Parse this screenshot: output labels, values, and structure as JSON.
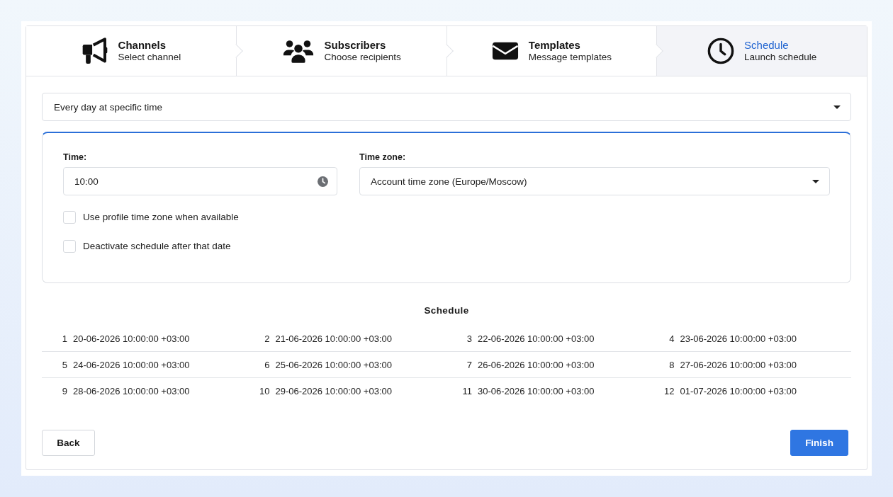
{
  "steps": [
    {
      "title": "Channels",
      "subtitle": "Select channel",
      "selected": false
    },
    {
      "title": "Subscribers",
      "subtitle": "Choose recipients",
      "selected": false
    },
    {
      "title": "Templates",
      "subtitle": "Message templates",
      "selected": false
    },
    {
      "title": "Schedule",
      "subtitle": "Launch schedule",
      "selected": true
    }
  ],
  "frequency_select": {
    "value": "Every day at specific time"
  },
  "time_field": {
    "label": "Time:",
    "value": "10:00"
  },
  "timezone_select": {
    "label": "Time zone:",
    "value": "Account time zone (Europe/Moscow)"
  },
  "options": [
    {
      "label": "Use profile time zone when available",
      "checked": false
    },
    {
      "label": "Deactivate schedule after that date",
      "checked": false
    }
  ],
  "schedule": {
    "title": "Schedule",
    "entries": [
      {
        "number": "1",
        "datetime": "20-06-2026 10:00:00 +03:00"
      },
      {
        "number": "2",
        "datetime": "21-06-2026 10:00:00 +03:00"
      },
      {
        "number": "3",
        "datetime": "22-06-2026 10:00:00 +03:00"
      },
      {
        "number": "4",
        "datetime": "23-06-2026 10:00:00 +03:00"
      },
      {
        "number": "5",
        "datetime": "24-06-2026 10:00:00 +03:00"
      },
      {
        "number": "6",
        "datetime": "25-06-2026 10:00:00 +03:00"
      },
      {
        "number": "7",
        "datetime": "26-06-2026 10:00:00 +03:00"
      },
      {
        "number": "8",
        "datetime": "27-06-2026 10:00:00 +03:00"
      },
      {
        "number": "9",
        "datetime": "28-06-2026 10:00:00 +03:00"
      },
      {
        "number": "10",
        "datetime": "29-06-2026 10:00:00 +03:00"
      },
      {
        "number": "11",
        "datetime": "30-06-2026 10:00:00 +03:00"
      },
      {
        "number": "12",
        "datetime": "01-07-2026 10:00:00 +03:00"
      }
    ]
  },
  "buttons": [
    {
      "label": "Back",
      "kind": "secondary"
    },
    {
      "label": "Finish",
      "kind": "primary"
    }
  ]
}
